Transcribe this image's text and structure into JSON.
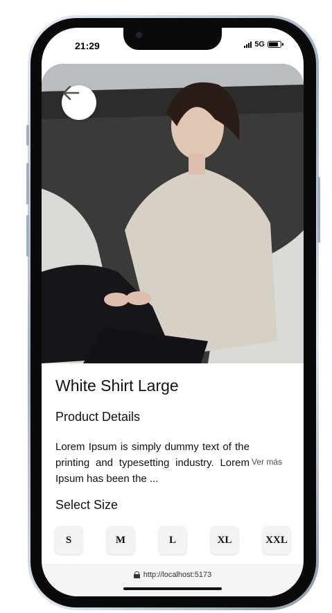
{
  "status_bar": {
    "time": "21:29",
    "network": "5G"
  },
  "product": {
    "title": "White Shirt Large",
    "details_heading": "Product Details",
    "description": "Lorem Ipsum is simply dummy text of the printing and typesetting industry. Lorem Ipsum has been the ...",
    "read_more": "Ver más",
    "image_icon": "product-photo"
  },
  "sizes": {
    "heading": "Select Size",
    "options": [
      "S",
      "M",
      "L",
      "XL",
      "XXL"
    ]
  },
  "browser": {
    "url": "http://localhost:5173"
  },
  "icons": {
    "back": "arrow-left-icon",
    "lock": "lock-icon"
  },
  "colors": {
    "accent": "#5a4a3f",
    "size_button_bg": "#f3f3f3"
  }
}
